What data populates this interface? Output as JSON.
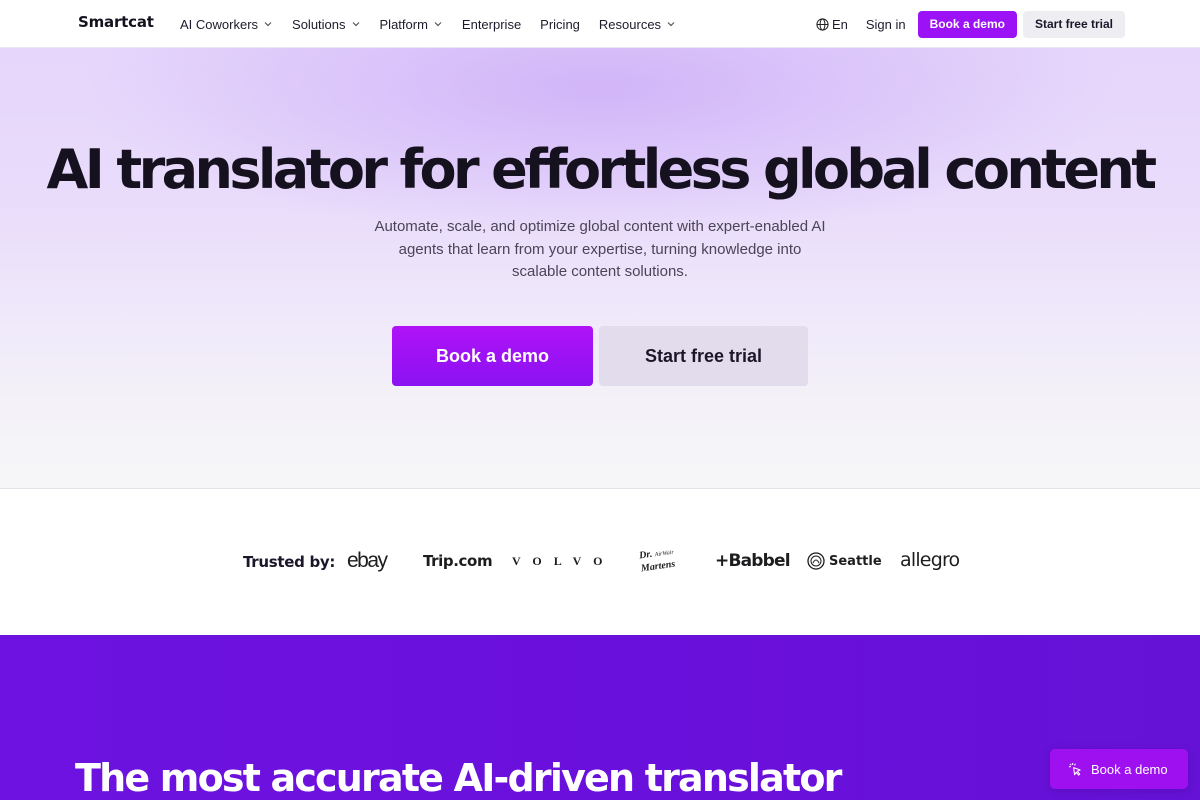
{
  "nav": {
    "logo": "Smartcat",
    "menu": [
      {
        "label": "AI Coworkers",
        "has_dropdown": true
      },
      {
        "label": "Solutions",
        "has_dropdown": true
      },
      {
        "label": "Platform",
        "has_dropdown": true
      },
      {
        "label": "Enterprise",
        "has_dropdown": false
      },
      {
        "label": "Pricing",
        "has_dropdown": false
      },
      {
        "label": "Resources",
        "has_dropdown": true
      }
    ],
    "language": {
      "label": "En",
      "icon": "globe-icon"
    },
    "sign_in": "Sign in",
    "book_demo": "Book a demo",
    "start_trial": "Start free trial"
  },
  "hero": {
    "title": "AI translator for effortless global content",
    "subtitle": "Automate, scale, and optimize global content with expert-enabled AI agents that learn from your expertise, turning knowledge into scalable content solutions.",
    "book_demo": "Book a demo",
    "start_trial": "Start free trial"
  },
  "trusted": {
    "label": "Trusted by:",
    "logos": [
      "ebay",
      "Trip.com",
      "VOLVO",
      "Dr. Martens",
      "+Babbel",
      "Seattle",
      "allegro"
    ],
    "drm_top": "Dr.",
    "drm_script": "AirWair",
    "drm_main": "Martens"
  },
  "section": {
    "title": "The most accurate AI-driven translator"
  },
  "floating_cta": {
    "label": "Book a demo",
    "icon": "cursor-click-icon"
  },
  "colors": {
    "accent": "#9a12f5",
    "purple_section": "#6a10db",
    "secondary_button": "#eeedf1"
  }
}
